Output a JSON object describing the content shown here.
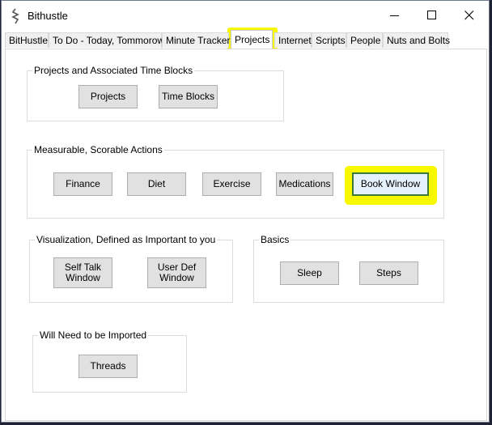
{
  "window": {
    "title": "Bithustle"
  },
  "tabs": [
    {
      "label": "BitHustle"
    },
    {
      "label": "To Do - Today, Tommorow"
    },
    {
      "label": "Minute Tracker"
    },
    {
      "label": "Projects"
    },
    {
      "label": "Internet"
    },
    {
      "label": "Scripts"
    },
    {
      "label": "People"
    },
    {
      "label": "Nuts and Bolts"
    }
  ],
  "active_tab": "Projects",
  "groups": {
    "projects": {
      "label": "Projects and Associated Time Blocks",
      "buttons": [
        "Projects",
        "Time Blocks"
      ]
    },
    "measurable": {
      "label": "Measurable, Scorable Actions",
      "buttons": [
        "Finance",
        "Diet",
        "Exercise",
        "Medications",
        "Book Window"
      ]
    },
    "visualization": {
      "label": "Visualization, Defined as Important to you",
      "buttons": [
        "Self Talk Window",
        "User Def Window"
      ]
    },
    "basics": {
      "label": "Basics",
      "buttons": [
        "Sleep",
        "Steps"
      ]
    },
    "imported": {
      "label": "Will Need to be Imported",
      "buttons": [
        "Threads"
      ]
    }
  },
  "highlight_color": "#f7f700"
}
